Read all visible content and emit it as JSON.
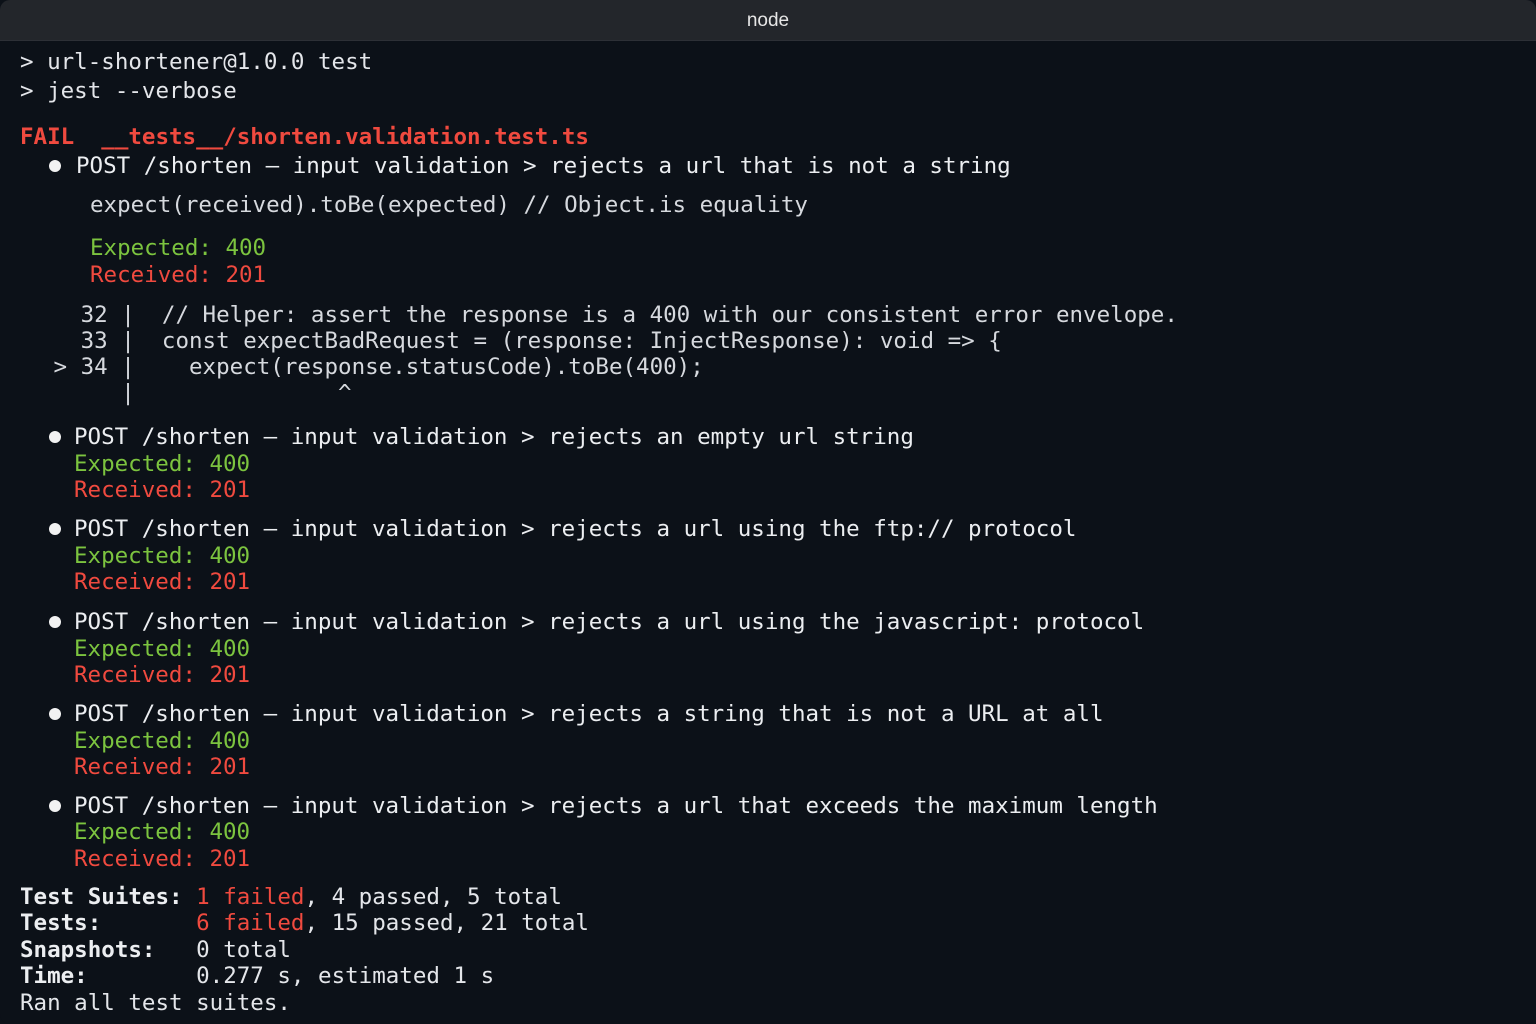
{
  "window": {
    "title": "node"
  },
  "command": {
    "line1": "> url-shortener@1.0.0 test",
    "line2": "> jest --verbose"
  },
  "fail_header": {
    "label": "FAIL",
    "file": "__tests__/shorten.validation.test.ts"
  },
  "first_failure": {
    "title": "POST /shorten — input validation > rejects a url that is not a string",
    "matcher": "expect(received).toBe(expected) // Object.is equality",
    "expected_label": "Expected: ",
    "expected_value": "400",
    "received_label": "Received: ",
    "received_value": "201",
    "code": [
      {
        "gutter": "   32 | ",
        "text": " // Helper: assert the response is a 400 with our consistent error envelope."
      },
      {
        "gutter": "   33 | ",
        "text": " const expectBadRequest = (response: InjectResponse): void => {"
      },
      {
        "gutter": " > 34 | ",
        "text": "   expect(response.statusCode).toBe(400);"
      },
      {
        "gutter": "      | ",
        "text": "              ^"
      }
    ]
  },
  "failures": [
    {
      "title": "POST /shorten — input validation > rejects an empty url string",
      "expected_label": "Expected: ",
      "expected_value": "400",
      "received_label": "Received: ",
      "received_value": "201"
    },
    {
      "title": "POST /shorten — input validation > rejects a url using the ftp:// protocol",
      "expected_label": "Expected: ",
      "expected_value": "400",
      "received_label": "Received: ",
      "received_value": "201"
    },
    {
      "title": "POST /shorten — input validation > rejects a url using the javascript: protocol",
      "expected_label": "Expected: ",
      "expected_value": "400",
      "received_label": "Received: ",
      "received_value": "201"
    },
    {
      "title": "POST /shorten — input validation > rejects a string that is not a URL at all",
      "expected_label": "Expected: ",
      "expected_value": "400",
      "received_label": "Received: ",
      "received_value": "201"
    },
    {
      "title": "POST /shorten — input validation > rejects a url that exceeds the maximum length",
      "expected_label": "Expected: ",
      "expected_value": "400",
      "received_label": "Received: ",
      "received_value": "201"
    }
  ],
  "summary": {
    "suites_label": "Test Suites: ",
    "suites_failed": "1 failed",
    "suites_rest": ", 4 passed, 5 total",
    "tests_label": "Tests:       ",
    "tests_failed": "6 failed",
    "tests_rest": ", 15 passed, 21 total",
    "snapshots_label": "Snapshots:   ",
    "snapshots_value": "0 total",
    "time_label": "Time:        ",
    "time_value": "0.277 s, estimated 1 s",
    "footer": "Ran all test suites."
  },
  "colors": {
    "background": "#0c1118",
    "fail_red": "#f04a3f",
    "pass_green": "#7cc43f",
    "text": "#e4e6ea"
  }
}
